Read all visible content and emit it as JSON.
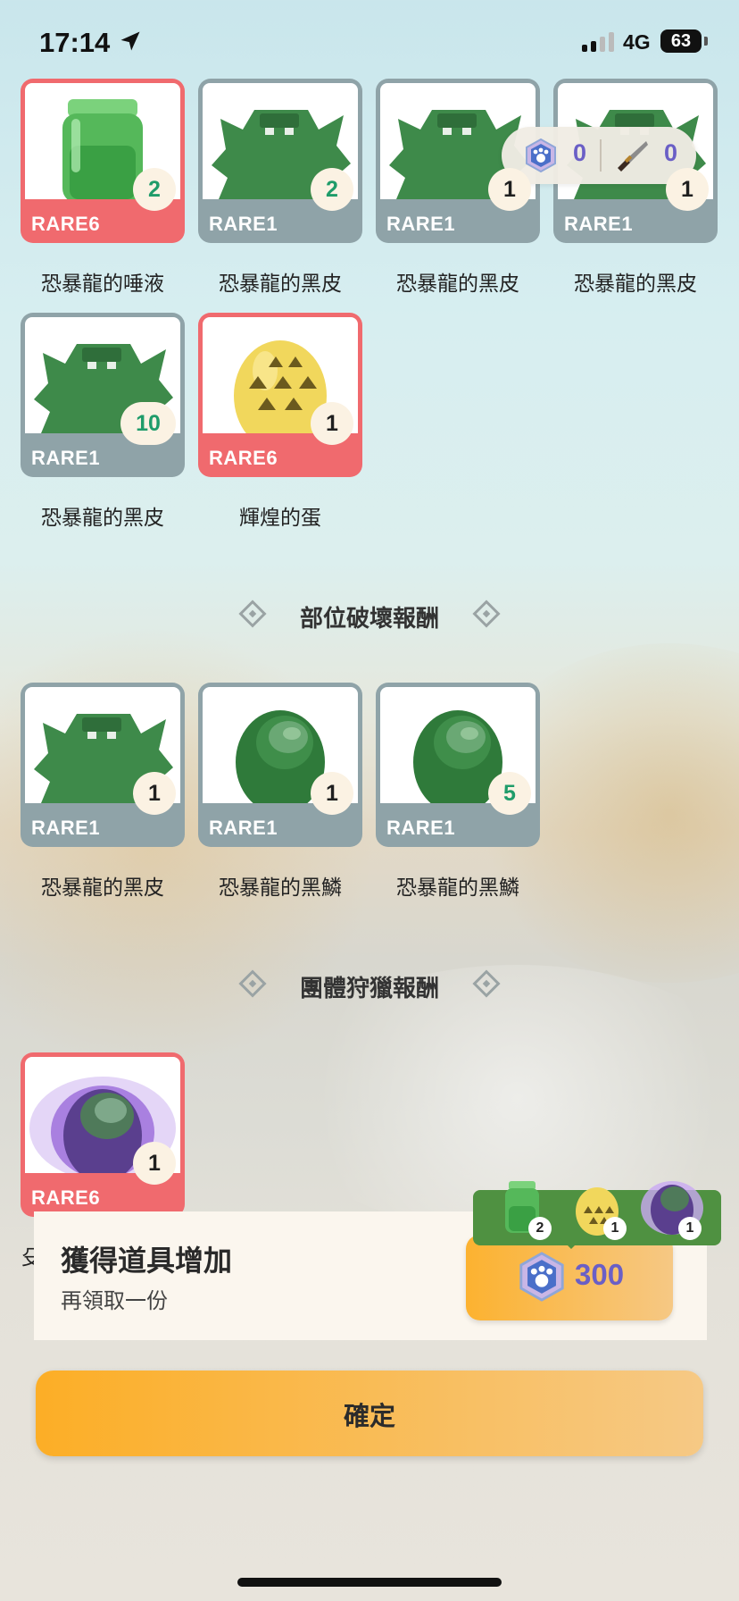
{
  "status": {
    "time": "17:14",
    "network": "4G",
    "battery": "63"
  },
  "currency": {
    "paw": "0",
    "knife": "0"
  },
  "items_main": [
    {
      "name": "恐暴龍的唾液",
      "rarity": "RARE6",
      "count": "2",
      "icon": "jar-icon"
    },
    {
      "name": "恐暴龍的黑皮",
      "rarity": "RARE1",
      "count": "2",
      "icon": "hide-icon"
    },
    {
      "name": "恐暴龍的黑皮",
      "rarity": "RARE1",
      "count": "1",
      "icon": "hide-icon"
    },
    {
      "name": "恐暴龍的黑皮",
      "rarity": "RARE1",
      "count": "1",
      "icon": "hide-icon"
    },
    {
      "name": "恐暴龍的黑皮",
      "rarity": "RARE1",
      "count": "10",
      "icon": "hide-icon"
    },
    {
      "name": "輝煌的蛋",
      "rarity": "RARE6",
      "count": "1",
      "icon": "egg-icon"
    }
  ],
  "section_break": {
    "title": "部位破壞報酬"
  },
  "items_break": [
    {
      "name": "恐暴龍的黑皮",
      "rarity": "RARE1",
      "count": "1",
      "icon": "hide-icon"
    },
    {
      "name": "恐暴龍的黑鱗",
      "rarity": "RARE1",
      "count": "1",
      "icon": "scale-icon"
    },
    {
      "name": "恐暴龍的黑鱗",
      "rarity": "RARE1",
      "count": "5",
      "icon": "scale-icon"
    }
  ],
  "section_group": {
    "title": "團體狩獵報酬"
  },
  "items_group": [
    {
      "name": "",
      "rarity": "RARE6",
      "count": "1",
      "icon": "purple-orb-icon"
    }
  ],
  "bonus": {
    "title": "獲得道具增加",
    "subtitle": "再領取一份",
    "cost": "300",
    "partial_name": "殳",
    "mini_counts": [
      "2",
      "1",
      "1"
    ]
  },
  "confirm_label": "確定"
}
